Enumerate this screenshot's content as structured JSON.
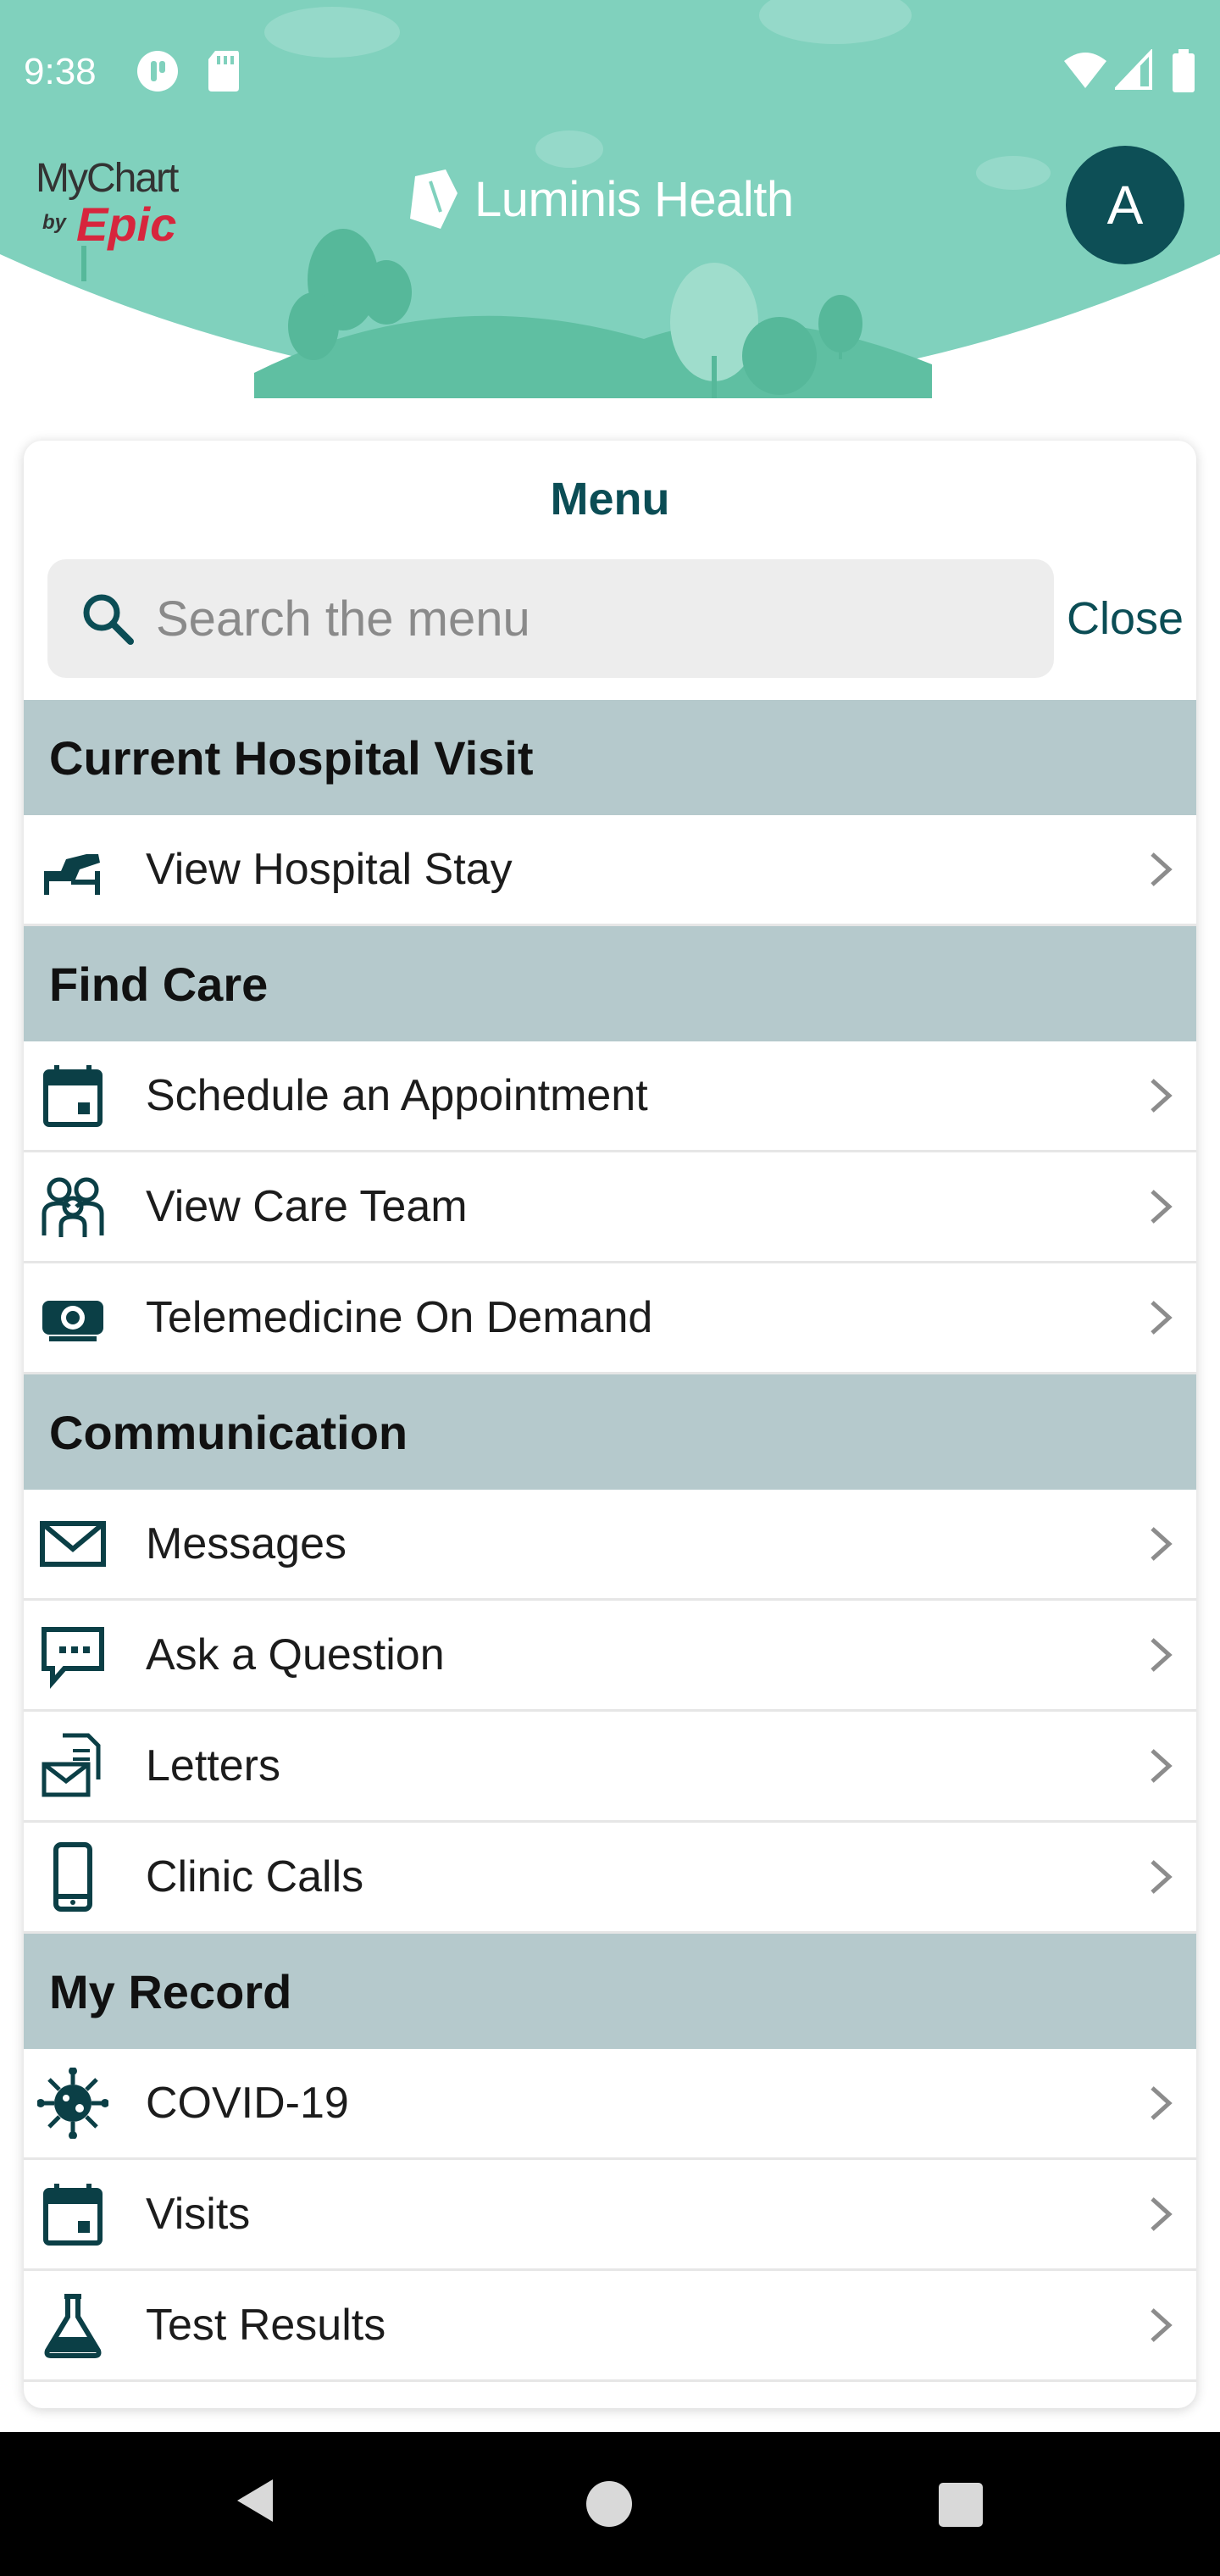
{
  "status_bar": {
    "time": "9:38"
  },
  "header": {
    "mychart_logo": "MyChart by Epic",
    "brand_name": "Luminis Health",
    "avatar_initial": "A"
  },
  "menu": {
    "title": "Menu",
    "search_placeholder": "Search the menu",
    "close_label": "Close",
    "sections": [
      {
        "title": "Current Hospital Visit",
        "items": [
          {
            "label": "View Hospital Stay",
            "icon": "hospital-bed-icon"
          }
        ]
      },
      {
        "title": "Find Care",
        "items": [
          {
            "label": "Schedule an Appointment",
            "icon": "calendar-icon"
          },
          {
            "label": "View Care Team",
            "icon": "care-team-icon"
          },
          {
            "label": "Telemedicine On Demand",
            "icon": "webcam-icon"
          }
        ]
      },
      {
        "title": "Communication",
        "items": [
          {
            "label": "Messages",
            "icon": "envelope-icon"
          },
          {
            "label": "Ask a Question",
            "icon": "chat-bubble-icon"
          },
          {
            "label": "Letters",
            "icon": "letters-icon"
          },
          {
            "label": "Clinic Calls",
            "icon": "phone-icon"
          }
        ]
      },
      {
        "title": "My Record",
        "items": [
          {
            "label": "COVID-19",
            "icon": "virus-icon"
          },
          {
            "label": "Visits",
            "icon": "calendar-icon"
          },
          {
            "label": "Test Results",
            "icon": "flask-icon"
          }
        ]
      }
    ]
  },
  "colors": {
    "header_teal": "#7fd0bc",
    "brand_dark": "#0b4d55",
    "section_bg": "#b5c9cc",
    "avatar_bg": "#0d4f56"
  }
}
